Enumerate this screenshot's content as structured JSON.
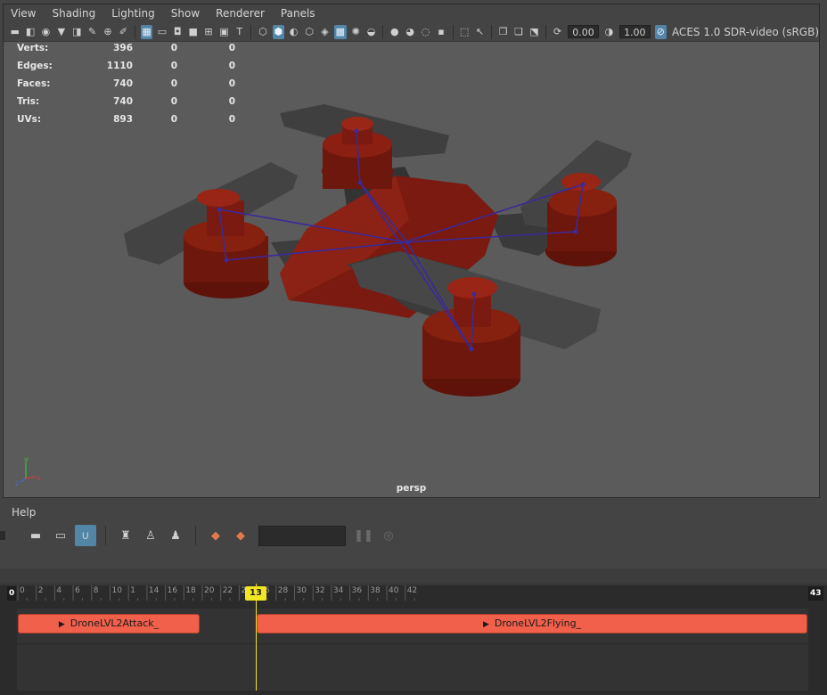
{
  "viewport": {
    "menu": [
      "View",
      "Shading",
      "Lighting",
      "Show",
      "Renderer",
      "Panels"
    ],
    "toolbar": {
      "field_a": "0.00",
      "field_b": "1.00",
      "color_management": "ACES 1.0 SDR-video (sRGB)"
    },
    "hud": {
      "rows": [
        {
          "label": "Verts:",
          "v1": "396",
          "v2": "0",
          "v3": "0"
        },
        {
          "label": "Edges:",
          "v1": "1110",
          "v2": "0",
          "v3": "0"
        },
        {
          "label": "Faces:",
          "v1": "740",
          "v2": "0",
          "v3": "0"
        },
        {
          "label": "Tris:",
          "v1": "740",
          "v2": "0",
          "v3": "0"
        },
        {
          "label": "UVs:",
          "v1": "893",
          "v2": "0",
          "v3": "0"
        }
      ]
    },
    "camera_label": "persp",
    "axis_labels": {
      "x": "x",
      "y": "y",
      "z": "z"
    },
    "model_colors": {
      "body": "#7a1a10",
      "arms": "#3a3a3a",
      "rig": "#3a2a9a"
    }
  },
  "help_bar": {
    "help_label": "Help"
  },
  "time_editor": {
    "start_frame": "0",
    "end_frame": "43",
    "current_frame": "13",
    "ticks": [
      "0",
      "2",
      "4",
      "6",
      "8",
      "10",
      "1",
      "14",
      "16",
      "18",
      "20",
      "22",
      "24",
      "26",
      "28",
      "30",
      "32",
      "34",
      "36",
      "38",
      "40",
      "42"
    ],
    "clips": [
      {
        "name": "DroneLVL2Attack_"
      },
      {
        "name": "DroneLVL2Flying_"
      }
    ],
    "colors": {
      "clip": "#f0604a",
      "current": "#f2e522"
    }
  }
}
